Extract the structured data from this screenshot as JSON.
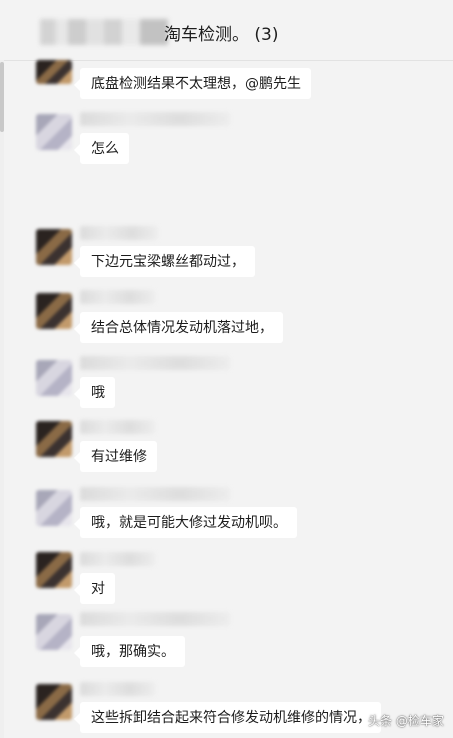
{
  "header": {
    "title": "淘车检测。 (3)"
  },
  "messages": [
    {
      "text": "底盘检测结果不太理想，@鹏先生"
    },
    {
      "text": "怎么"
    },
    {
      "text": "下边元宝梁螺丝都动过，"
    },
    {
      "text": "结合总体情况发动机落过地，"
    },
    {
      "text": "哦"
    },
    {
      "text": "有过维修"
    },
    {
      "text": "哦，就是可能大修过发动机呗。"
    },
    {
      "text": "对"
    },
    {
      "text": "哦，那确实。"
    },
    {
      "text": "这些拆卸结合起来符合修发动机维修的情况，"
    }
  ],
  "watermark": "头条 @检车家"
}
